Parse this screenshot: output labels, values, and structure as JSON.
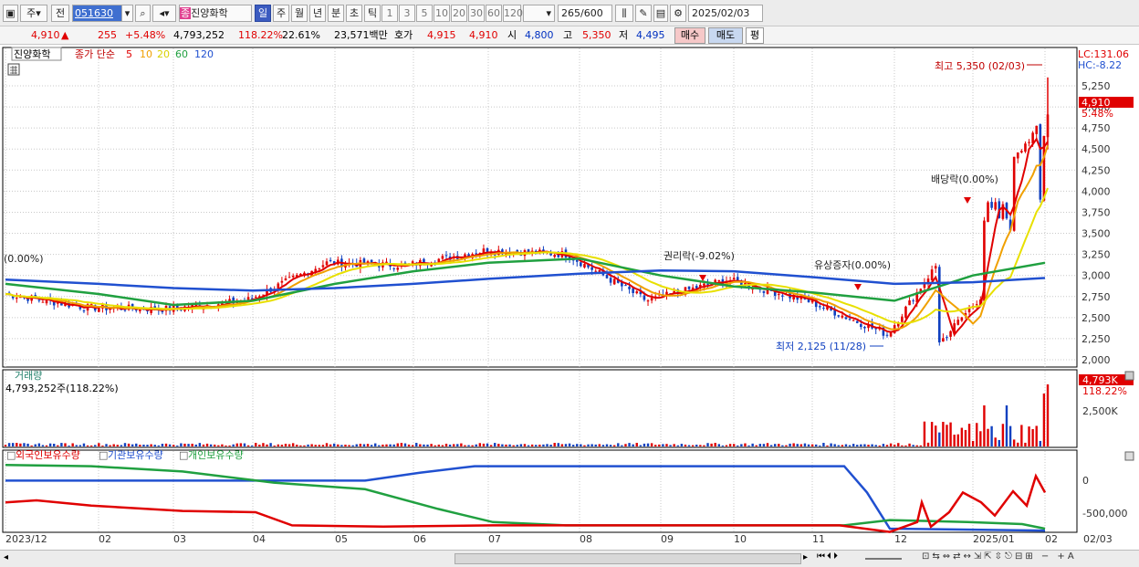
{
  "toolbar": {
    "type_label": "주",
    "prev_label": "전",
    "stock_code": "051630",
    "stock_badge": "종",
    "stock_name": "진양화학",
    "periods": [
      "일",
      "주",
      "월",
      "년",
      "분",
      "초",
      "틱"
    ],
    "numbers": [
      "1",
      "3",
      "5",
      "10",
      "20",
      "30",
      "60",
      "120"
    ],
    "count": "265",
    "count_total": "/600",
    "date": "2025/02/03"
  },
  "quote": {
    "price": "4,910",
    "change_arrow": "▲",
    "change": "255",
    "change_pct": "+5.48%",
    "volume": "4,793,252",
    "volume_ratio": "118.22%",
    "turnover": "22.61%",
    "amount": "23,571백만",
    "bid_label": "호가",
    "ask_price": "4,915",
    "bid_price": "4,910",
    "open_label": "시",
    "open": "4,800",
    "high_label": "고",
    "high": "5,350",
    "low_label": "저",
    "low": "4,495",
    "buy_label": "매수",
    "sell_label": "매도",
    "eval_label": "평"
  },
  "price_panel": {
    "name": "진양화학",
    "legend_prefix": "종가 단순",
    "ma": [
      {
        "label": "5",
        "color": "#e00000"
      },
      {
        "label": "10",
        "color": "#f0a000"
      },
      {
        "label": "20",
        "color": "#e8e000"
      },
      {
        "label": "60",
        "color": "#20a040"
      },
      {
        "label": "120",
        "color": "#2050d0"
      }
    ],
    "lc": "LC:131.06",
    "hc": "HC:-8.22",
    "last_price": "4,910",
    "last_pct": "5.48%",
    "annotations": {
      "high": "최고 5,350 (02/03)",
      "low": "최저 2,125 (11/28)",
      "rights": "권리락(-9.02%)",
      "capital": "유상증자(0.00%)",
      "dividend": "배당락(0.00%)",
      "left": "(0.00%)"
    }
  },
  "volume_panel": {
    "title": "거래량",
    "value": "4,793,252주(118.22%)",
    "last": "4,793K",
    "last_pct": "118.22%",
    "tick": "2,500K"
  },
  "holdings_panel": {
    "legend": [
      {
        "label": "외국인보유수량",
        "color": "#e00000"
      },
      {
        "label": "기관보유수량",
        "color": "#2050d0"
      },
      {
        "label": "개인보유수량",
        "color": "#20a040"
      }
    ],
    "ticks": [
      "0",
      "-500,000"
    ]
  },
  "x_axis": [
    "2023/12",
    "02",
    "03",
    "04",
    "05",
    "06",
    "07",
    "08",
    "09",
    "10",
    "11",
    "12",
    "2025/01",
    "02"
  ],
  "x_axis_right": "02/03",
  "chart_data": [
    {
      "type": "candlestick",
      "title": "진양화학",
      "y_ticks": [
        2000,
        2250,
        2500,
        2750,
        3000,
        3250,
        3500,
        3750,
        4000,
        4250,
        4500,
        4750,
        5000,
        5250
      ],
      "ylim": [
        2000,
        5300
      ],
      "last_close": 4910,
      "high": {
        "value": 5350,
        "date": "02/03"
      },
      "low": {
        "value": 2125,
        "date": "11/28"
      },
      "months": [
        "2023/12",
        "02",
        "03",
        "04",
        "05",
        "06",
        "07",
        "08",
        "09",
        "10",
        "11",
        "12",
        "2025/01",
        "02"
      ],
      "close_monthly_approx": [
        2780,
        2620,
        2600,
        2700,
        3150,
        3120,
        3300,
        3250,
        2700,
        2950,
        2700,
        2300,
        3650,
        4910
      ],
      "series": [
        {
          "name": "5",
          "type": "line"
        },
        {
          "name": "10",
          "type": "line"
        },
        {
          "name": "20",
          "type": "line"
        },
        {
          "name": "60",
          "type": "line",
          "values_monthly_approx": [
            2900,
            2780,
            2650,
            2700,
            2900,
            3050,
            3150,
            3200,
            3000,
            2870,
            2800,
            2700,
            3000,
            3150
          ]
        },
        {
          "name": "120",
          "type": "line",
          "values_monthly_approx": [
            2950,
            2900,
            2850,
            2820,
            2850,
            2900,
            2960,
            3020,
            3060,
            3050,
            2980,
            2900,
            2920,
            2970
          ]
        }
      ]
    },
    {
      "type": "bar",
      "title": "거래량",
      "last_value": 4793252,
      "ticks": [
        "2,500K"
      ]
    },
    {
      "type": "line",
      "series": [
        {
          "name": "외국인보유수량",
          "color": "#e00000"
        },
        {
          "name": "기관보유수량",
          "color": "#2050d0"
        },
        {
          "name": "개인보유수량",
          "color": "#20a040"
        }
      ],
      "ticks": [
        0,
        -500000
      ]
    }
  ]
}
